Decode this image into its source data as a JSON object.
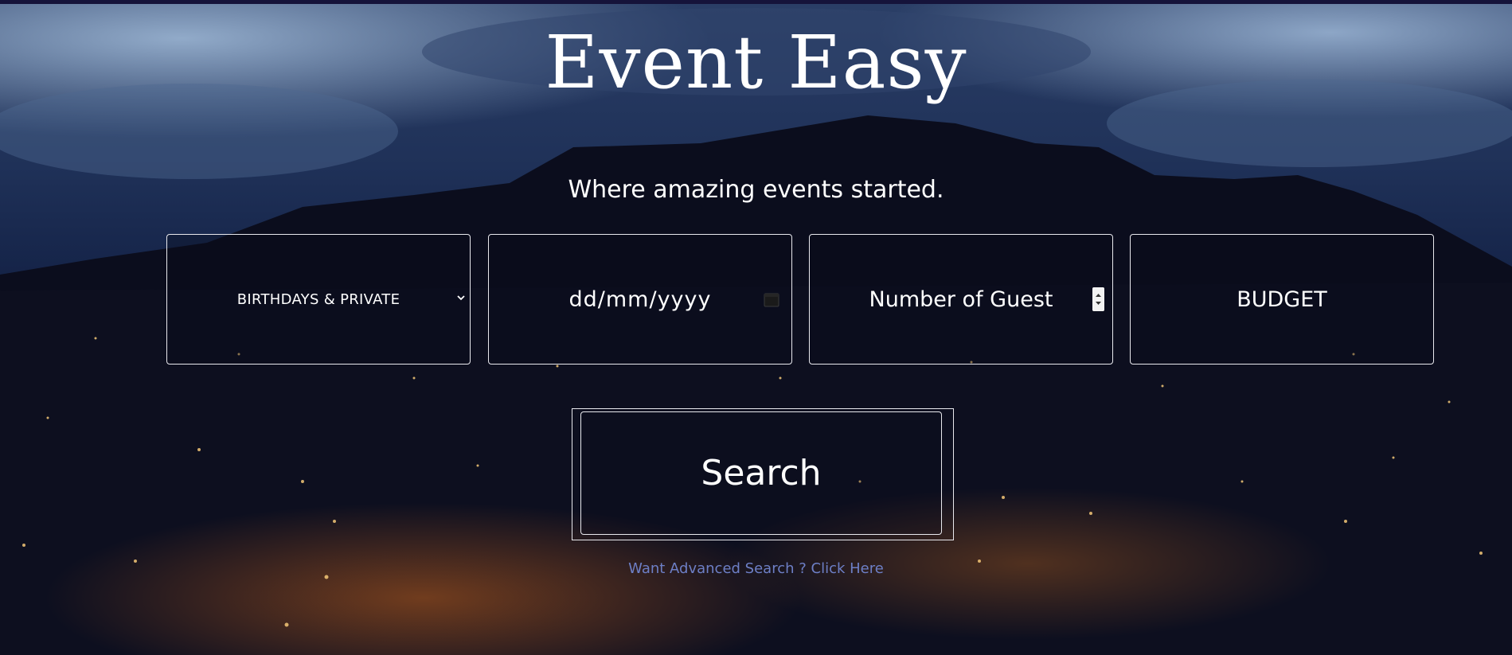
{
  "hero": {
    "title": "Event Easy",
    "tagline": "Where amazing events started."
  },
  "form": {
    "event_type_selected": "BIRTHDAYS & PRIVATE",
    "date_placeholder": "dd/mm/yyyy",
    "guests_placeholder": "Number of Guest",
    "budget_placeholder": "BUDGET",
    "search_label": "Search",
    "advanced_link": "Want Advanced Search ? Click Here"
  },
  "icons": {
    "select": "chevron-down-icon",
    "date": "calendar-icon",
    "number": "spinner-icon"
  },
  "colors": {
    "text": "#ffffff",
    "field_border": "#e9e9ee",
    "link": "#6d7fc6",
    "top_strip": "#15133a"
  }
}
